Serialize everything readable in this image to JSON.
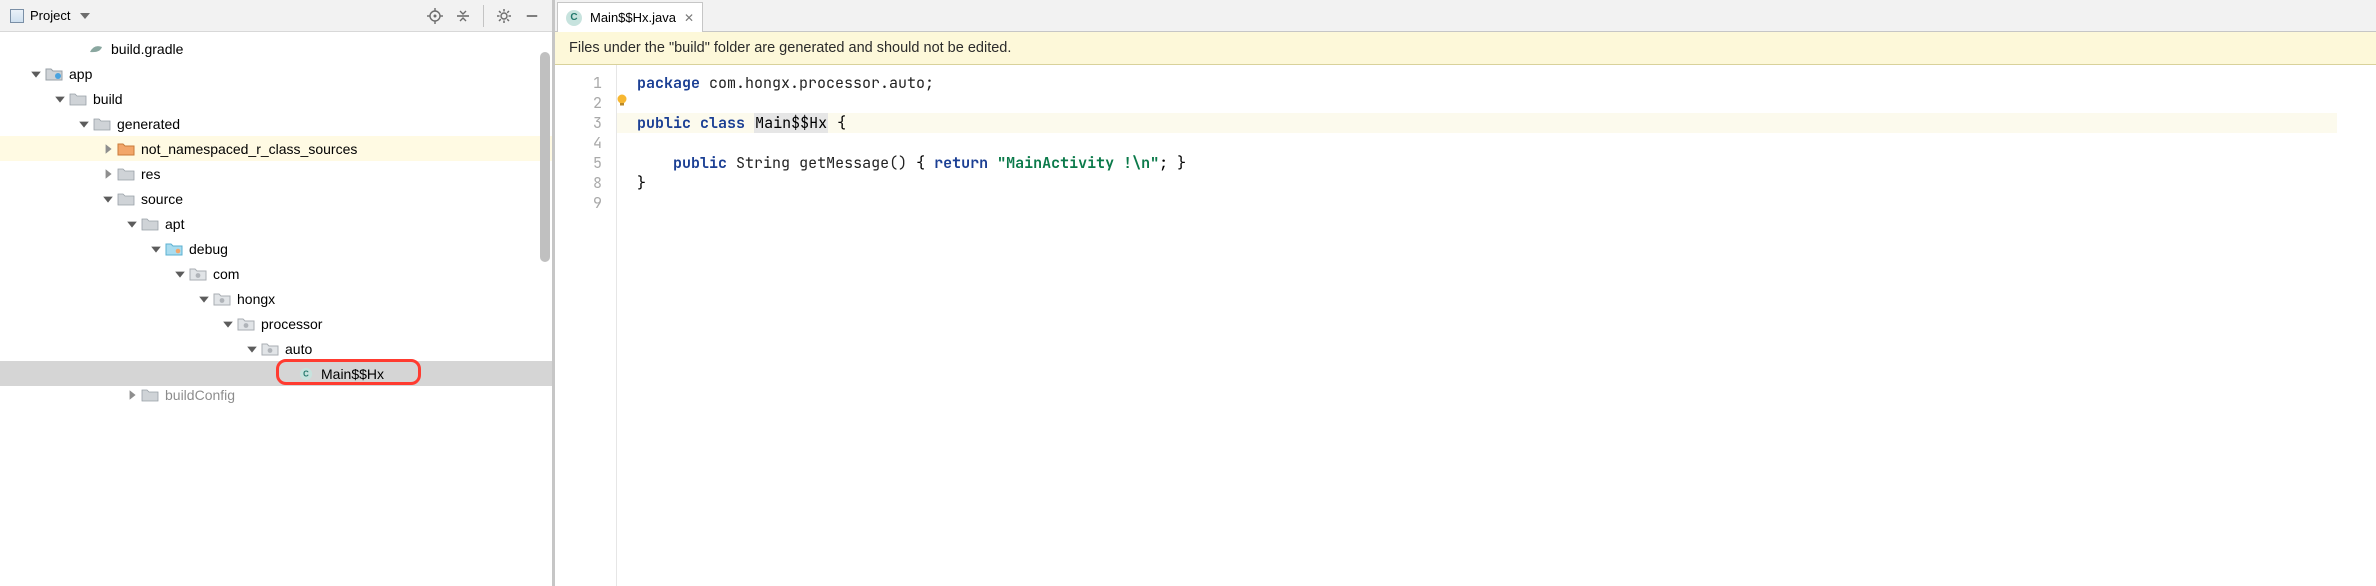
{
  "panel": {
    "title": "Project"
  },
  "tree": {
    "items": [
      {
        "indent": 72,
        "arrow": "none",
        "icon": "gradle",
        "label": "build.gradle"
      },
      {
        "indent": 30,
        "arrow": "down",
        "icon": "module",
        "label": "app"
      },
      {
        "indent": 54,
        "arrow": "down",
        "icon": "folder",
        "label": "build"
      },
      {
        "indent": 78,
        "arrow": "down",
        "icon": "folder",
        "label": "generated"
      },
      {
        "indent": 102,
        "arrow": "right",
        "icon": "src",
        "label": "not_namespaced_r_class_sources",
        "hl": "yellow"
      },
      {
        "indent": 102,
        "arrow": "right",
        "icon": "folder",
        "label": "res"
      },
      {
        "indent": 102,
        "arrow": "down",
        "icon": "folder",
        "label": "source"
      },
      {
        "indent": 126,
        "arrow": "down",
        "icon": "folder",
        "label": "apt"
      },
      {
        "indent": 150,
        "arrow": "down",
        "icon": "gensrc",
        "label": "debug"
      },
      {
        "indent": 174,
        "arrow": "down",
        "icon": "pkg",
        "label": "com"
      },
      {
        "indent": 198,
        "arrow": "down",
        "icon": "pkg",
        "label": "hongx"
      },
      {
        "indent": 222,
        "arrow": "down",
        "icon": "pkg",
        "label": "processor"
      },
      {
        "indent": 246,
        "arrow": "down",
        "icon": "pkg",
        "label": "auto"
      },
      {
        "indent": 282,
        "arrow": "none",
        "icon": "class",
        "label": "Main$$Hx",
        "hl": "select",
        "ring": true
      },
      {
        "indent": 126,
        "arrow": "right",
        "icon": "folder",
        "label": "buildConfig",
        "partial": true
      }
    ]
  },
  "tab": {
    "filename": "Main$$Hx.java"
  },
  "banner": {
    "text": "Files under the \"build\" folder are generated and should not be edited."
  },
  "gutter": [
    "1",
    "2",
    "3",
    "4",
    "5",
    "8",
    "9"
  ],
  "code": {
    "package_kw": "package",
    "package_name": " com.hongx.processor.auto;",
    "public_kw": "public",
    "class_kw": "class",
    "class_name": "Main$$Hx",
    "brace_open": " {",
    "method_indent": "    ",
    "string_kw": "String",
    "method_name": " getMessage() ",
    "return_kw": "return",
    "string_lit": "\"MainActivity !\\n\"",
    "brace_close": "}"
  }
}
